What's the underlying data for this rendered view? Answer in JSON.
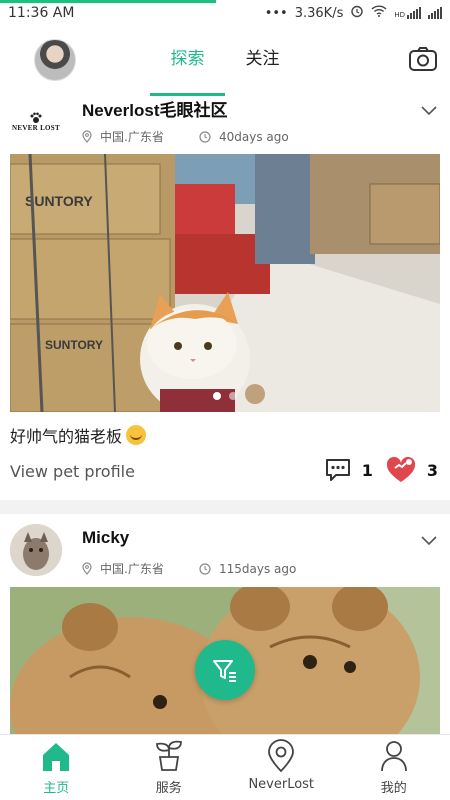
{
  "status_bar": {
    "time": "11:36 AM",
    "dots": "•••",
    "speed": "3.36K/s",
    "network_label": "HD",
    "load_progress": 0.48
  },
  "header": {
    "tabs": [
      {
        "label": "探索",
        "active": true
      },
      {
        "label": "关注",
        "active": false
      }
    ],
    "camera_icon": "camera-icon"
  },
  "posts": [
    {
      "user_name": "Neverlost毛眼社区",
      "logo_text": "NEVER LOST",
      "location": "中国.广东省",
      "time_ago": "40days ago",
      "caption": "好帅气的猫老板",
      "view_profile": "View pet profile",
      "comment_count": "1",
      "like_count": "3",
      "carousel": {
        "count": 2,
        "active_index": 0
      }
    },
    {
      "user_name": "Micky",
      "location": "中国.广东省",
      "time_ago": "115days ago"
    }
  ],
  "bottom_nav": [
    {
      "label": "主页",
      "icon": "home-icon",
      "active": true
    },
    {
      "label": "服务",
      "icon": "plant-pot-icon",
      "active": false
    },
    {
      "label": "NeverLost",
      "icon": "location-pin-icon",
      "active": false
    },
    {
      "label": "我的",
      "icon": "person-icon",
      "active": false
    }
  ],
  "colors": {
    "accent": "#20b98c",
    "like": "#e0474c"
  }
}
